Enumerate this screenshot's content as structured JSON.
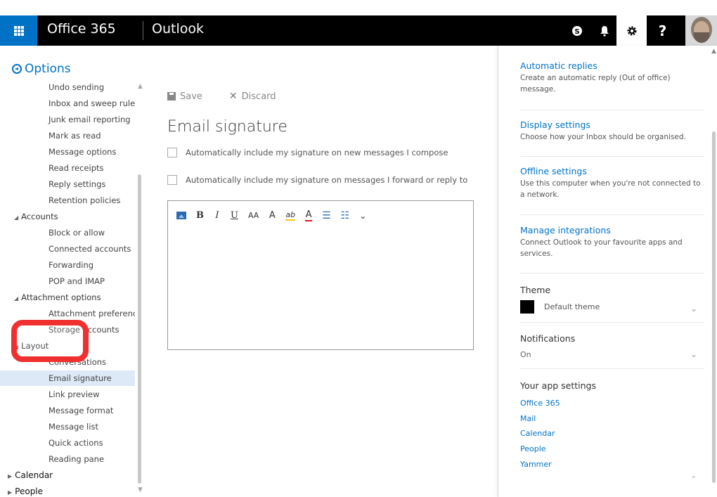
{
  "header": {
    "brand": "Office 365",
    "app": "Outlook",
    "help_label": "?"
  },
  "options": {
    "title": "Options"
  },
  "nav": [
    {
      "label": "Undo sending",
      "level": 2
    },
    {
      "label": "Inbox and sweep rules",
      "level": 2
    },
    {
      "label": "Junk email reporting",
      "level": 2
    },
    {
      "label": "Mark as read",
      "level": 2
    },
    {
      "label": "Message options",
      "level": 2
    },
    {
      "label": "Read receipts",
      "level": 2
    },
    {
      "label": "Reply settings",
      "level": 2
    },
    {
      "label": "Retention policies",
      "level": 2
    },
    {
      "label": "Accounts",
      "level": 1
    },
    {
      "label": "Block or allow",
      "level": 2
    },
    {
      "label": "Connected accounts",
      "level": 2
    },
    {
      "label": "Forwarding",
      "level": 2
    },
    {
      "label": "POP and IMAP",
      "level": 2
    },
    {
      "label": "Attachment options",
      "level": 1
    },
    {
      "label": "Attachment preferences",
      "level": 2
    },
    {
      "label": "Storage accounts",
      "level": 2
    },
    {
      "label": "Layout",
      "level": 1
    },
    {
      "label": "Conversations",
      "level": 2
    },
    {
      "label": "Email signature",
      "level": 2,
      "selected": true
    },
    {
      "label": "Link preview",
      "level": 2
    },
    {
      "label": "Message format",
      "level": 2
    },
    {
      "label": "Message list",
      "level": 2
    },
    {
      "label": "Quick actions",
      "level": 2
    },
    {
      "label": "Reading pane",
      "level": 2
    },
    {
      "label": "Calendar",
      "level": 0
    },
    {
      "label": "People",
      "level": 0
    }
  ],
  "main": {
    "save_label": "Save",
    "discard_label": "Discard",
    "title": "Email signature",
    "check1": "Automatically include my signature on new messages I compose",
    "check2": "Automatically include my signature on messages I forward or reply to"
  },
  "editor_tools": [
    "B",
    "I",
    "U",
    "AA",
    "A",
    "ab",
    "A"
  ],
  "right_panel": {
    "sections": [
      {
        "title": "Automatic replies",
        "desc": "Create an automatic reply (Out of office) message."
      },
      {
        "title": "Display settings",
        "desc": "Choose how your Inbox should be organised."
      },
      {
        "title": "Offline settings",
        "desc": "Use this computer when you're not connected to a network."
      },
      {
        "title": "Manage integrations",
        "desc": "Connect Outlook to your favourite apps and services."
      }
    ],
    "theme_heading": "Theme",
    "theme_value": "Default theme",
    "notifications_heading": "Notifications",
    "notifications_value": "On",
    "app_settings_heading": "Your app settings",
    "app_links": [
      "Office 365",
      "Mail",
      "Calendar",
      "People",
      "Yammer"
    ]
  },
  "colors": {
    "brand_blue": "#0072c6",
    "highlight_red": "#f0302e",
    "selected_bg": "#dde9f6"
  }
}
